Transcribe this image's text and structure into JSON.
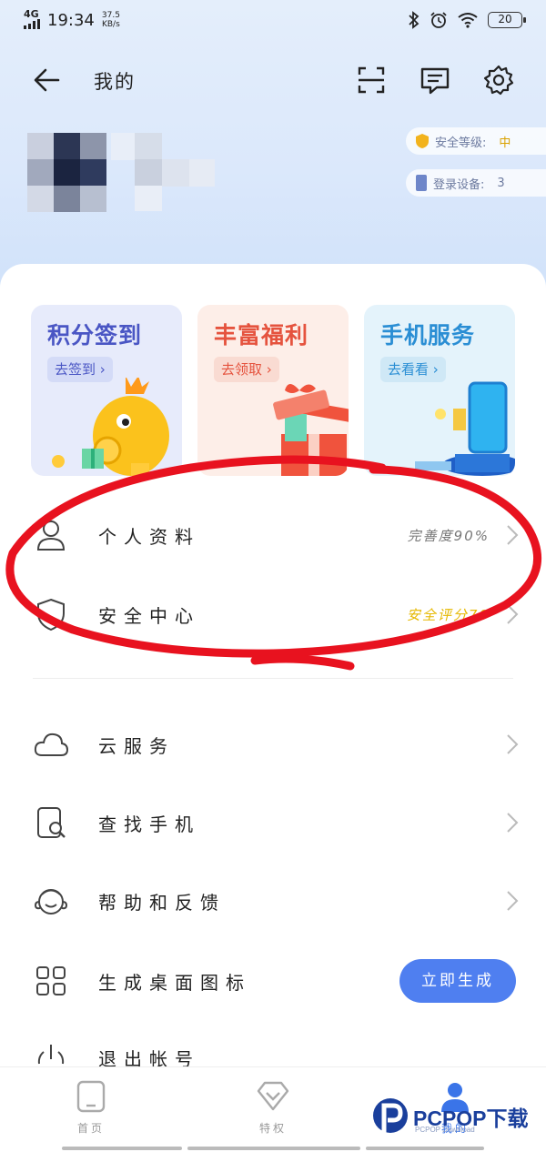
{
  "status_bar": {
    "network": "4G",
    "time": "19:34",
    "speed_value": "37.5",
    "speed_unit": "KB/s",
    "battery": "20"
  },
  "header": {
    "title": "我的"
  },
  "profile": {
    "security_level_label": "安全等级:",
    "security_level_value": "中",
    "devices_label": "登录设备:",
    "devices_value": "3"
  },
  "promos": [
    {
      "title": "积分签到",
      "button": "去签到 ›",
      "title_color": "#4a56c4",
      "bg": "#e7ebfb",
      "btn_bg": "#d4dbf7"
    },
    {
      "title": "丰富福利",
      "button": "去领取 ›",
      "title_color": "#e5533e",
      "bg": "#fdeee8",
      "btn_bg": "#f9dbd2"
    },
    {
      "title": "手机服务",
      "button": "去看看 ›",
      "title_color": "#2a8ed4",
      "bg": "#e4f3fb",
      "btn_bg": "#cfe8f6"
    }
  ],
  "menu": [
    {
      "label": "个人资料",
      "value": "完善度90%"
    },
    {
      "label": "安全中心",
      "value": "安全评分70",
      "value_color": "#e6b800"
    },
    {
      "label": "云服务",
      "value": ""
    },
    {
      "label": "查找手机",
      "value": ""
    },
    {
      "label": "帮助和反馈",
      "value": ""
    },
    {
      "label": "生成桌面图标",
      "button": "立即生成"
    },
    {
      "label": "退出帐号",
      "value": ""
    }
  ],
  "bottom_nav": [
    {
      "label": "首页"
    },
    {
      "label": "特权"
    },
    {
      "label": "我的"
    }
  ],
  "watermark": {
    "text": "PCPOP下载",
    "sub": "PCPOP Download"
  },
  "colors": {
    "accent": "#4f7ff0",
    "annotation": "#e8121f"
  }
}
